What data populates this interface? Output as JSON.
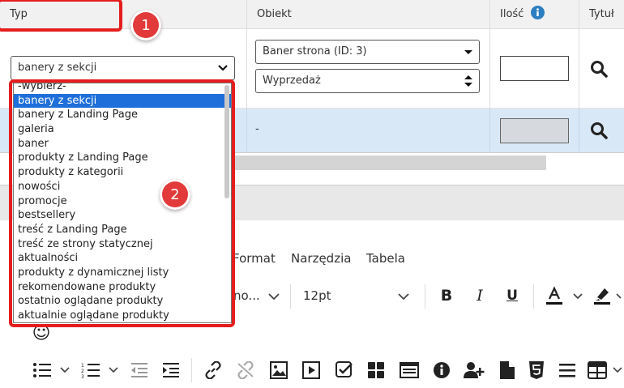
{
  "table": {
    "headers": {
      "typ": "Typ",
      "obiekt": "Obiekt",
      "ilosc": "Ilość",
      "tytul": "Tytuł"
    },
    "row1": {
      "typ_selected": "banery z sekcji",
      "obiekt_select": "Baner strona (ID: 3)",
      "obiekt_sub_select": "Wyprzedaż"
    },
    "row2": {
      "obiekt_text": "-"
    }
  },
  "dropdown": {
    "options": [
      "-wybierz-",
      "banery z sekcji",
      "banery z Landing Page",
      "galeria",
      "baner",
      "produkty z Landing Page",
      "produkty z kategorii",
      "nowości",
      "promocje",
      "bestsellery",
      "treść z Landing Page",
      "treść ze strony statycznej",
      "aktualności",
      "produkty z dynamicznej listy",
      "rekomendowane produkty",
      "ostatnio oglądane produkty",
      "aktualnie oglądane produkty"
    ],
    "selected_index": 1
  },
  "editor": {
    "menu": {
      "format": "Format",
      "narzedzia": "Narzędzia",
      "tabela": "Tabela"
    },
    "font_name_partial": "no...",
    "font_size": "12pt",
    "emoji": "☺"
  },
  "annotations": {
    "badge1": "1",
    "badge2": "2"
  },
  "colors": {
    "accent": "#1e6fd9",
    "highlight_row": "#d9e8f6",
    "annotation_red": "#e51d1d",
    "info_icon": "#2d7fc1"
  }
}
